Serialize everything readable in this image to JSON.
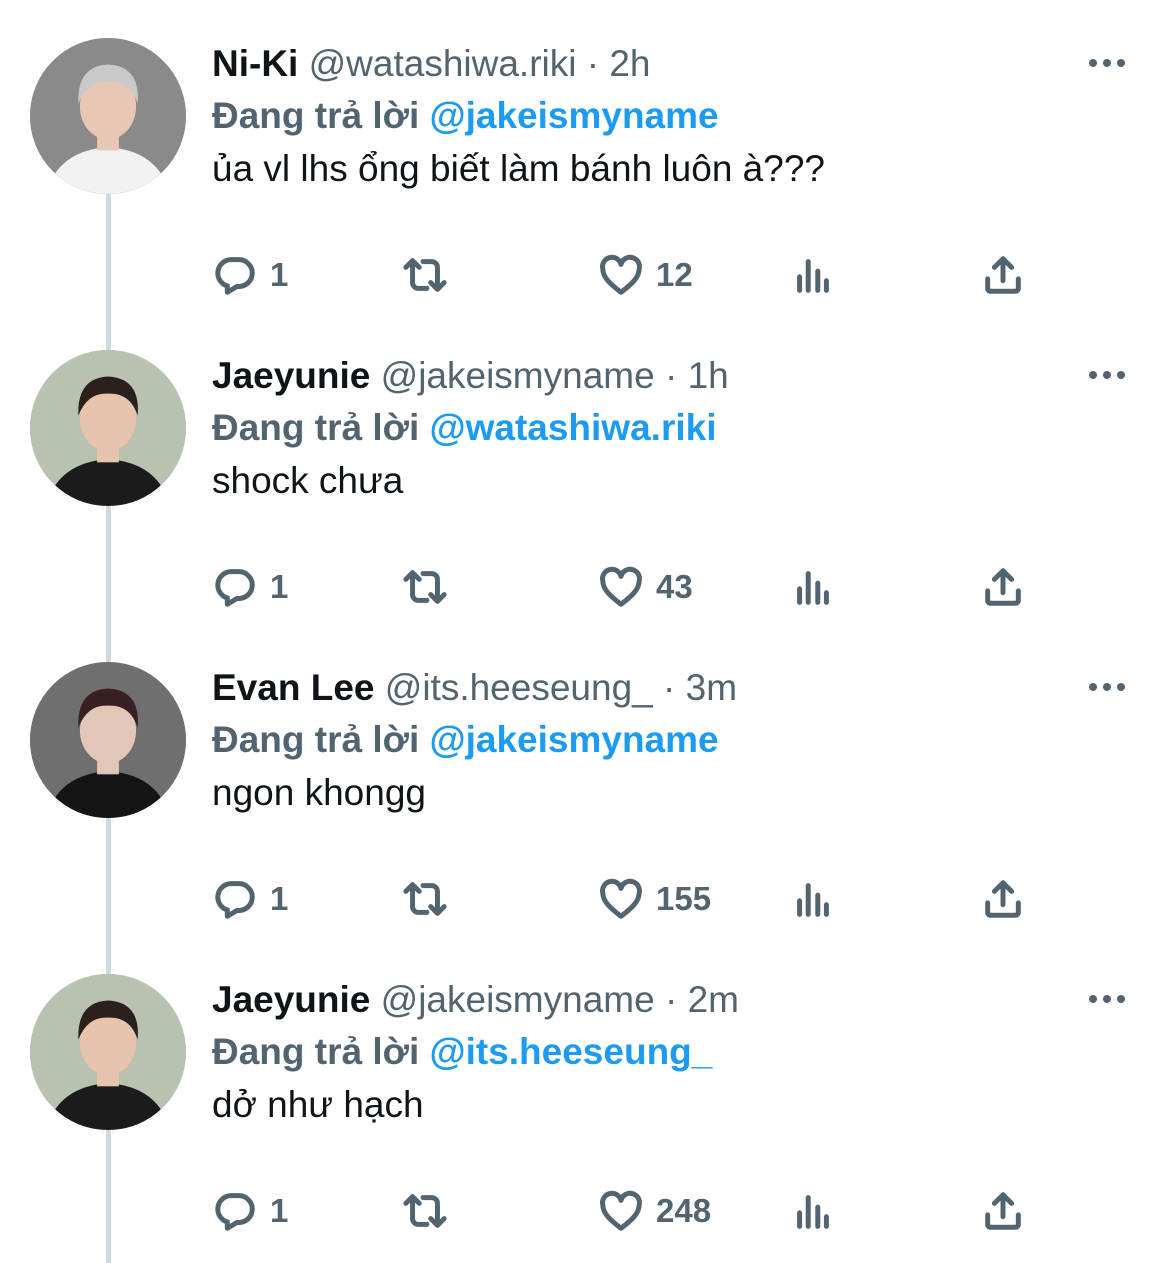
{
  "reply_prefix": "Đang trả lời",
  "tweets": [
    {
      "name": "Ni-Ki",
      "handle": "@watashiwa.riki",
      "sep": "·",
      "time": "2h",
      "reply_to": "@jakeismyname",
      "text": "ủa vl lhs ổng biết làm bánh luôn à???",
      "replies": "1",
      "likes": "12",
      "avatar_colors": {
        "bg": "#8a8a8a",
        "hair": "#c9c9c9",
        "skin": "#e8c8b5",
        "shirt": "#f2f2f2"
      }
    },
    {
      "name": "Jaeyunie",
      "handle": "@jakeismyname",
      "sep": "·",
      "time": "1h",
      "reply_to": "@watashiwa.riki",
      "text": "shock chưa",
      "replies": "1",
      "likes": "43",
      "avatar_colors": {
        "bg": "#b9c2b1",
        "hair": "#2a211c",
        "skin": "#e7c4ad",
        "shirt": "#1b1b1b"
      }
    },
    {
      "name": "Evan Lee",
      "handle": "@its.heeseung_",
      "sep": "·",
      "time": "3m",
      "reply_to": "@jakeismyname",
      "text": "ngon khongg",
      "replies": "1",
      "likes": "155",
      "avatar_colors": {
        "bg": "#6f6f6f",
        "hair": "#3a1f22",
        "skin": "#e2c6b8",
        "shirt": "#141414"
      }
    },
    {
      "name": "Jaeyunie",
      "handle": "@jakeismyname",
      "sep": "·",
      "time": "2m",
      "reply_to": "@its.heeseung_",
      "text": "dở như hạch",
      "replies": "1",
      "likes": "248",
      "avatar_colors": {
        "bg": "#b9c2b1",
        "hair": "#2a211c",
        "skin": "#e7c4ad",
        "shirt": "#1b1b1b"
      }
    }
  ],
  "colors": {
    "text": "#0f1419",
    "secondary": "#536471",
    "mention": "#1d9bf0",
    "thread_line": "#cfd9de"
  },
  "icons": [
    "reply-icon",
    "retweet-icon",
    "like-icon",
    "views-icon",
    "share-icon",
    "more-icon"
  ]
}
